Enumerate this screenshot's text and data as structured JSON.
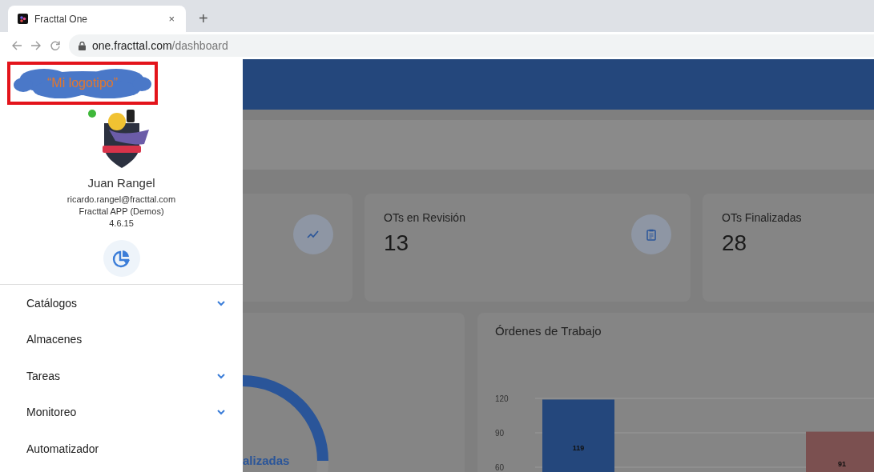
{
  "browser": {
    "tab": {
      "title": "Fracttal One",
      "close": "×",
      "new_tab": "+"
    },
    "url": {
      "host": "one.fracttal.com",
      "path": "/dashboard"
    }
  },
  "drawer": {
    "logo": "“Mi logotipo”",
    "user": {
      "online": true,
      "name": "Juan Rangel",
      "email": "ricardo.rangel@fracttal.com",
      "company": "Fracttal APP (Demos)",
      "version": "4.6.15"
    },
    "menu": [
      {
        "label": "Catálogos",
        "expandable": true
      },
      {
        "label": "Almacenes",
        "expandable": false
      },
      {
        "label": "Tareas",
        "expandable": true
      },
      {
        "label": "Monitoreo",
        "expandable": true
      },
      {
        "label": "Automatizador",
        "expandable": false
      }
    ]
  },
  "stats": [
    {
      "kind": "cut"
    },
    {
      "kind": "full",
      "title": "OTs en Revisión",
      "value": "13"
    },
    {
      "kind": "full",
      "title": "OTs Finalizadas",
      "value": "28"
    }
  ],
  "gauge": {
    "label": "alizadas"
  },
  "orders": {
    "chart_data": {
      "type": "bar",
      "title": "Órdenes de Trabajo",
      "ylim": [
        34,
        120
      ],
      "yticks": [
        60,
        90,
        120
      ],
      "data_labels": true,
      "series": [
        {
          "color": "#24477c",
          "values": [
            119,
            null
          ]
        },
        {
          "color": "#7b5050",
          "values": [
            null,
            91
          ]
        }
      ]
    }
  }
}
